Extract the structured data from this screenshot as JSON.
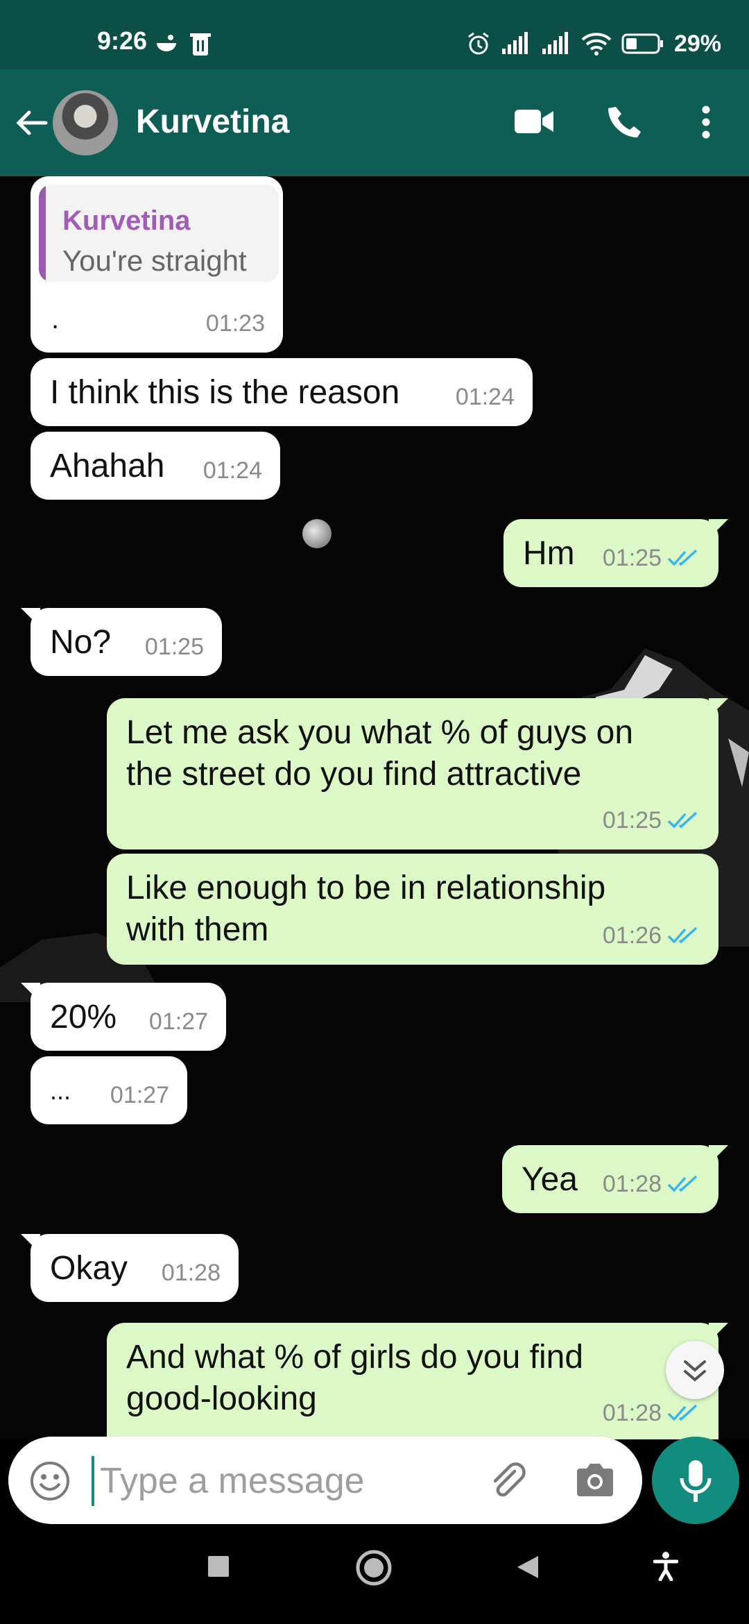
{
  "status_bar": {
    "time": "9:26",
    "battery": "29%"
  },
  "header": {
    "contact_name": "Kurvetina"
  },
  "messages": [
    {
      "direction": "in",
      "quote_author": "Kurvetina",
      "quote_text": "You're straight",
      "text": ".",
      "time": "01:23"
    },
    {
      "direction": "in",
      "text": "I think this is the reason",
      "time": "01:24"
    },
    {
      "direction": "in",
      "text": "Ahahah",
      "time": "01:24"
    },
    {
      "direction": "out",
      "text": "Hm",
      "time": "01:25",
      "status": "read"
    },
    {
      "direction": "in",
      "text": "No?",
      "time": "01:25"
    },
    {
      "direction": "out",
      "text": "Let me ask you what % of guys on\nthe street do you find attractive",
      "time": "01:25",
      "status": "read"
    },
    {
      "direction": "out",
      "text": "Like enough to be in relationship\nwith them",
      "time": "01:26",
      "status": "read"
    },
    {
      "direction": "in",
      "text": "20%",
      "time": "01:27"
    },
    {
      "direction": "in",
      "text": "...",
      "time": "01:27"
    },
    {
      "direction": "out",
      "text": "Yea",
      "time": "01:28",
      "status": "read"
    },
    {
      "direction": "in",
      "text": "Okay",
      "time": "01:28"
    },
    {
      "direction": "out",
      "text": "And what % of girls do you find\ngood-looking",
      "time": "01:28",
      "status": "read"
    }
  ],
  "composer": {
    "placeholder": "Type a message"
  },
  "colors": {
    "header": "#0f5e55",
    "status_bar": "#0b4f47",
    "outgoing_bubble": "#dcf8c6",
    "incoming_bubble": "#ffffff",
    "accent": "#128c7e",
    "read_ticks": "#34b7f1"
  },
  "icons": [
    "back-arrow-icon",
    "video-call-icon",
    "voice-call-icon",
    "more-options-icon",
    "emoji-icon",
    "attach-icon",
    "camera-icon",
    "mic-icon",
    "scroll-down-icon",
    "double-check-icon"
  ]
}
